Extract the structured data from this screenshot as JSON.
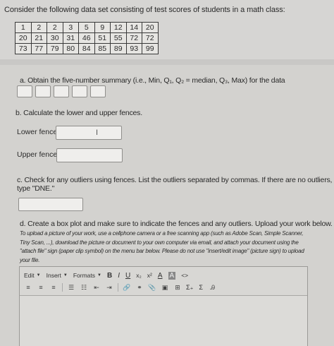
{
  "intro": "Consider the following data set consisting of test scores of students in a math class:",
  "table": [
    [
      "1",
      "2",
      "2",
      "3",
      "5",
      "9",
      "12",
      "14",
      "20"
    ],
    [
      "20",
      "21",
      "30",
      "31",
      "46",
      "51",
      "55",
      "72",
      "72"
    ],
    [
      "73",
      "77",
      "79",
      "80",
      "84",
      "85",
      "89",
      "93",
      "99"
    ]
  ],
  "part_a": "a. Obtain the five-number summary (i.e., Min, Q₁, Q₂ = median, Q₃, Max) for the data",
  "part_b": "b. Calculate the lower and upper fences.",
  "lower_label": "Lower fence:",
  "upper_label": "Upper fence:",
  "part_c_line1": "c. Check for any outliers using fences. List the outliers separated by commas. If there are no outliers,",
  "part_c_line2": "type \"DNE.\"",
  "part_d": "d. Create a box plot and make sure to indicate the fences and any outliers. Upload your work below.",
  "hint_lines": [
    "To upload a picture of your work, use a cellphone camera or a free scanning app (such as Adobe Scan, Simple Scanner,",
    "Tiny Scan, ...), download the picture or document to your own computer via email, and attach your document using the",
    "\"attach file\" sign (paper clip symbol) on the menu bar below. Please do not use \"insert/edit image\" (picture sign) to upload",
    "your file."
  ],
  "toolbar": {
    "edit": "Edit",
    "insert": "Insert",
    "formats": "Formats",
    "bold": "B",
    "italic": "I",
    "underline": "U",
    "subscript": "x₂",
    "superscript": "x²",
    "font_color": "A",
    "bg_color": "A",
    "code": "<>",
    "sum1": "Σ₊",
    "sum2": "Σ",
    "cursor_glyph": "I"
  }
}
